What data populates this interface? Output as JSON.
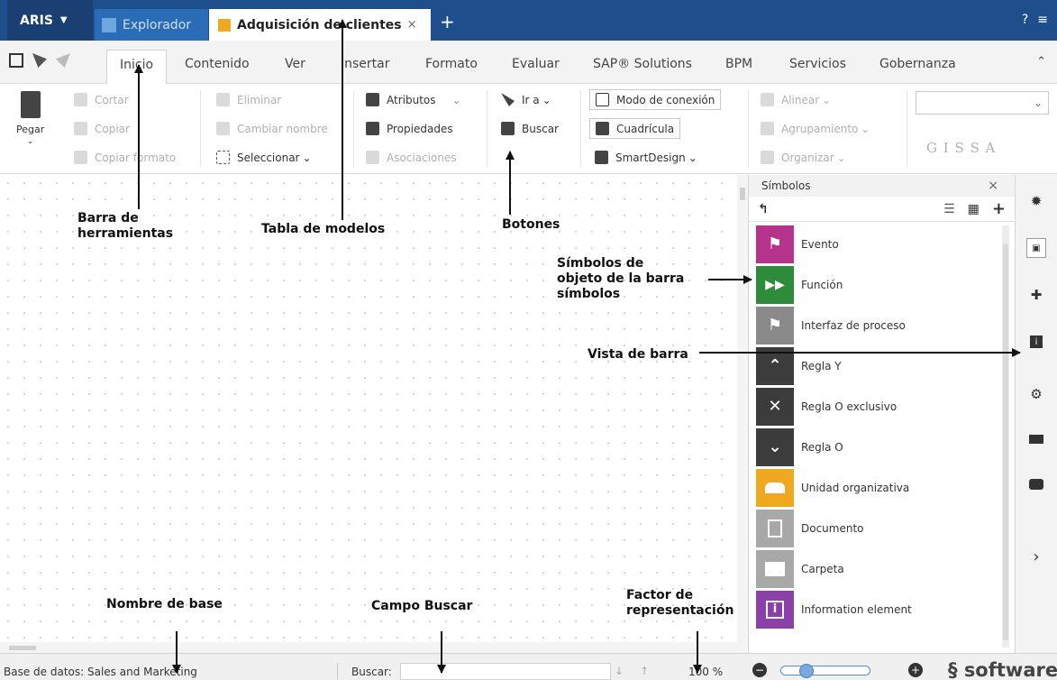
{
  "titlebar": {
    "app_name": "ARIS",
    "explorer_tab": "Explorador",
    "active_tab": "Adquisición de clientes",
    "close_symbol": "×",
    "add_symbol": "+",
    "help_symbol": "?",
    "menu_symbol": "≡",
    "brand_color": "#1e4f8c"
  },
  "ribbon_tabs": [
    "Inicio",
    "Contenido",
    "Ver",
    "Insertar",
    "Formato",
    "Evaluar",
    "SAP® Solutions",
    "BPM",
    "Servicios",
    "Gobernanza"
  ],
  "ribbon": {
    "paste": "Pegar",
    "cut": "Cortar",
    "copy": "Copiar",
    "copy_format": "Copiar formato",
    "delete": "Eliminar",
    "rename": "Cambiar nombre",
    "select": "Seleccionar",
    "attributes": "Atributos",
    "properties": "Propiedades",
    "associations": "Asociaciones",
    "goto": "Ir a",
    "search": "Buscar",
    "connection_mode": "Modo de conexión",
    "grid": "Cuadrícula",
    "smartdesign": "SmartDesign",
    "align": "Alinear",
    "grouping": "Agrupamiento",
    "arrange": "Organizar",
    "font_styles": "G  I  S  S  A"
  },
  "symbols_panel": {
    "title": "Símbolos",
    "close": "×",
    "items": [
      {
        "label": "Evento",
        "color": "#b5338a",
        "icon": "⚑"
      },
      {
        "label": "Función",
        "color": "#2e8b3a",
        "icon": "▶▶"
      },
      {
        "label": "Interfaz de proceso",
        "color": "#8a8a8a",
        "icon": "⚑"
      },
      {
        "label": "Regla Y",
        "color": "#3c3c3c",
        "icon": "⌃"
      },
      {
        "label": "Regla O exclusivo",
        "color": "#3c3c3c",
        "icon": "✕"
      },
      {
        "label": "Regla O",
        "color": "#3c3c3c",
        "icon": "⌄"
      },
      {
        "label": "Unidad organizativa",
        "color": "#f0a820",
        "icon": "👥"
      },
      {
        "label": "Documento",
        "color": "#a8a8a8",
        "icon": "▤"
      },
      {
        "label": "Carpeta",
        "color": "#a8a8a8",
        "icon": "▬"
      },
      {
        "label": "Information element",
        "color": "#8b3fa8",
        "icon": "i"
      }
    ]
  },
  "annotations": {
    "toolbar": "Barra de\nherramientas",
    "model_tab": "Tabla de modelos",
    "buttons": "Botones",
    "symbol_objects": "Símbolos de\nobjeto de la barra\nsímbolos",
    "bar_view": "Vista de barra",
    "db_name": "Nombre de base",
    "search_field": "Campo Buscar",
    "zoom_factor": "Factor de\nrepresentación"
  },
  "statusbar": {
    "database": "Base de datos: Sales and Marketing",
    "search_label": "Buscar:",
    "zoom": "100 %",
    "zoom_level_percent": 20,
    "brand": "softwareAG"
  }
}
